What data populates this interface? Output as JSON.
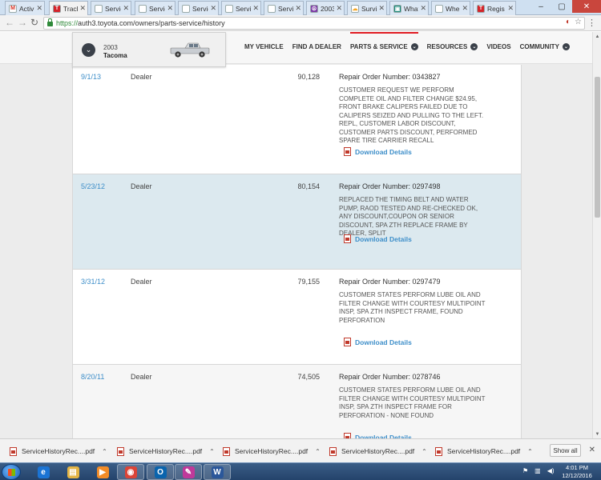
{
  "browser": {
    "tabs": [
      {
        "title": "Activ",
        "color": "#ffffff",
        "glyph": "M",
        "glyph_color": "#d93025"
      },
      {
        "title": "Track",
        "color": "#d4252b",
        "glyph": "T",
        "glyph_color": "#ffffff",
        "active": true
      },
      {
        "title": "Servic",
        "color": "#ffffff",
        "glyph": "",
        "glyph_color": "#333"
      },
      {
        "title": "Servic",
        "color": "#ffffff",
        "glyph": "",
        "glyph_color": "#333"
      },
      {
        "title": "Servic",
        "color": "#ffffff",
        "glyph": "",
        "glyph_color": "#333"
      },
      {
        "title": "Servic",
        "color": "#ffffff",
        "glyph": "",
        "glyph_color": "#333"
      },
      {
        "title": "Servic",
        "color": "#ffffff",
        "glyph": "",
        "glyph_color": "#333"
      },
      {
        "title": "2003",
        "color": "#7c3aa6",
        "glyph": "☮",
        "glyph_color": "#ffffff"
      },
      {
        "title": "Surviv",
        "color": "#ffffff",
        "glyph": "☁",
        "glyph_color": "#f5a623"
      },
      {
        "title": "What",
        "color": "#1a8a7a",
        "glyph": "▣",
        "glyph_color": "#ffffff"
      },
      {
        "title": "Whe",
        "color": "#ffffff",
        "glyph": "",
        "glyph_color": "#333"
      },
      {
        "title": "Regis",
        "color": "#d4252b",
        "glyph": "T",
        "glyph_color": "#ffffff"
      }
    ],
    "url_scheme": "https://",
    "url_rest": "auth3.toyota.com/owners/parts-service/history"
  },
  "vehicle": {
    "year": "2003",
    "model": "Tacoma"
  },
  "nav": [
    {
      "label": "MY VEHICLE",
      "dropdown": false
    },
    {
      "label": "FIND A DEALER",
      "dropdown": false
    },
    {
      "label": "PARTS & SERVICE",
      "dropdown": true,
      "active": true
    },
    {
      "label": "RESOURCES",
      "dropdown": true
    },
    {
      "label": "VIDEOS",
      "dropdown": false
    },
    {
      "label": "COMMUNITY",
      "dropdown": true
    }
  ],
  "records": [
    {
      "date": "9/1/13",
      "source": "Dealer",
      "mileage": "90,128",
      "repair_order": "Repair Order Number: 0343827",
      "description": "CUSTOMER REQUEST WE PERFORM COMPLETE OIL AND FILTER CHANGE $24.95, FRONT BRAKE CALIPERS FAILED DUE TO CALIPERS SEIZED AND PULLING TO THE LEFT. REPL, CUSTOMER LABOR DISCOUNT, CUSTOMER PARTS DISCOUNT, PERFORMED SPARE TIRE CARRIER RECALL",
      "download": "Download Details"
    },
    {
      "date": "5/23/12",
      "source": "Dealer",
      "mileage": "80,154",
      "repair_order": "Repair Order Number: 0297498",
      "description": "REPLACED THE TIMING BELT AND WATER PUMP, RAOD TESTED AND RE-CHECKED OK, ANY DISCOUNT,COUPON OR SENIOR DISCOUNT, SPA ZTH REPLACE FRAME BY DEALER, SPLIT",
      "download": "Download Details"
    },
    {
      "date": "3/31/12",
      "source": "Dealer",
      "mileage": "79,155",
      "repair_order": "Repair Order Number: 0297479",
      "description": "CUSTOMER STATES PERFORM LUBE OIL AND FILTER CHANGE WITH COURTESY MULTIPOINT INSP, SPA ZTH INSPECT FRAME, FOUND PERFORATION",
      "download": "Download Details"
    },
    {
      "date": "8/20/11",
      "source": "Dealer",
      "mileage": "74,505",
      "repair_order": "Repair Order Number: 0278746",
      "description": "CUSTOMER STATES PERFORM LUBE OIL AND FILTER CHANGE WITH COURTESY MULTIPOINT INSP, SPA ZTH INSPECT FRAME FOR PERFORATION - NONE FOUND",
      "download": "Download Details"
    }
  ],
  "downloads": {
    "files": [
      "ServiceHistoryRec....pdf",
      "ServiceHistoryRec....pdf",
      "ServiceHistoryRec....pdf",
      "ServiceHistoryRec....pdf",
      "ServiceHistoryRec....pdf"
    ],
    "show_all": "Show all"
  },
  "taskbar": {
    "apps": [
      {
        "name": "internet-explorer",
        "color": "#1b74d4",
        "glyph": "e"
      },
      {
        "name": "file-explorer",
        "color": "#e3b445",
        "glyph": "▤"
      },
      {
        "name": "media-player",
        "color": "#f28c28",
        "glyph": "▶"
      },
      {
        "name": "chrome",
        "color": "#db4437",
        "glyph": "◉"
      },
      {
        "name": "outlook",
        "color": "#0a64ad",
        "glyph": "O"
      },
      {
        "name": "paint",
        "color": "#c0399a",
        "glyph": "✎"
      },
      {
        "name": "word",
        "color": "#2b579a",
        "glyph": "W"
      }
    ],
    "time": "4:01 PM",
    "date": "12/12/2016"
  }
}
